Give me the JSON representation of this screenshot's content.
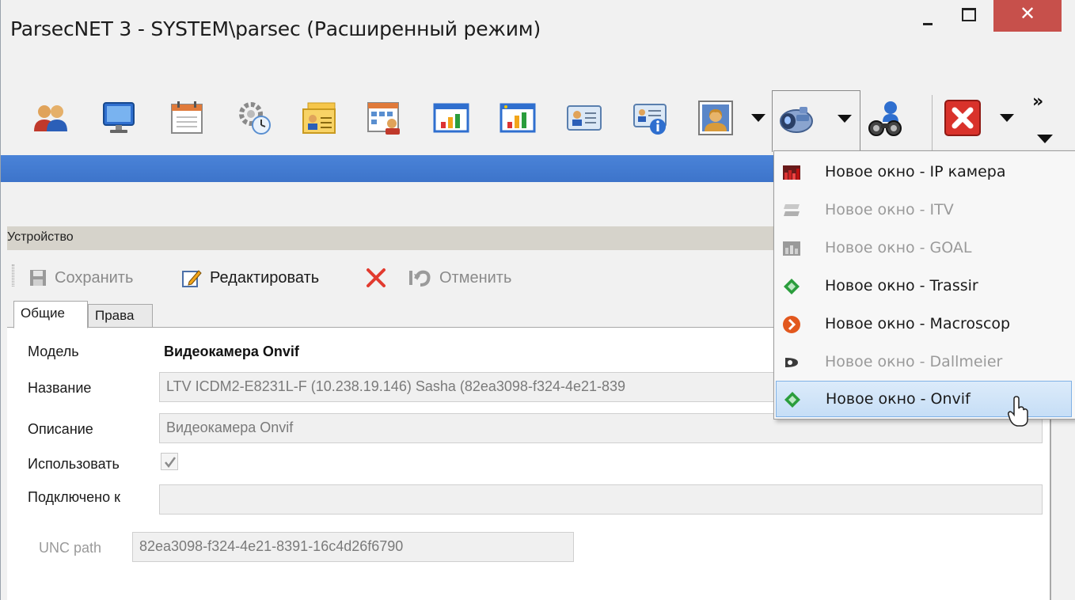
{
  "window": {
    "title": "ParsecNET 3 - SYSTEM\\parsec (Расширенный режим)",
    "close_glyph": "✕"
  },
  "toolbar": {
    "icons": [
      "users-icon",
      "monitor-icon",
      "calendar-icon",
      "schedule-gear-icon",
      "personnel-card-icon",
      "personnel-schedule-icon",
      "report-chart-icon",
      "report-chart-2-icon",
      "id-card-icon",
      "id-card-info-icon",
      "photo-person-icon",
      "video-camera-icon",
      "binoculars-person-icon",
      "close-red-icon"
    ],
    "overflow_glyph": "»"
  },
  "device_panel": {
    "header": "Устройство",
    "actions": {
      "save": "Сохранить",
      "edit": "Редактировать",
      "cancel": "Отменить"
    },
    "tabs": [
      "Общие",
      "Права"
    ],
    "fields": {
      "model_label": "Модель",
      "model_value": "Видеокамера Onvif",
      "name_label": "Название",
      "name_value": "LTV ICDM2-E8231L-F (10.238.19.146) Sasha (82ea3098-f324-4e21-839",
      "description_label": "Описание",
      "description_value": "Видеокамера Onvif",
      "use_label": "Использовать",
      "use_checked": true,
      "connected_label": "Подключено к",
      "connected_value": "",
      "unc_label": "UNC path",
      "unc_value": "82ea3098-f324-4e21-8391-16c4d26f6790"
    }
  },
  "video_menu": {
    "items": [
      {
        "label": "Новое окно - IP камера",
        "enabled": true,
        "icon": "ip-camera-icon"
      },
      {
        "label": "Новое окно - ITV",
        "enabled": false,
        "icon": "itv-icon"
      },
      {
        "label": "Новое окно - GOAL",
        "enabled": false,
        "icon": "goal-icon"
      },
      {
        "label": "Новое окно - Trassir",
        "enabled": true,
        "icon": "trassir-icon"
      },
      {
        "label": "Новое окно - Macroscop",
        "enabled": true,
        "icon": "macroscop-icon"
      },
      {
        "label": "Новое окно - Dallmeier",
        "enabled": false,
        "icon": "dallmeier-icon"
      },
      {
        "label": "Новое окно - Onvif",
        "enabled": true,
        "icon": "onvif-icon",
        "highlighted": true
      }
    ]
  },
  "colors": {
    "accent_blue": "#3d74ca",
    "close_red": "#c7504b",
    "menu_highlight": "#c6def6"
  }
}
